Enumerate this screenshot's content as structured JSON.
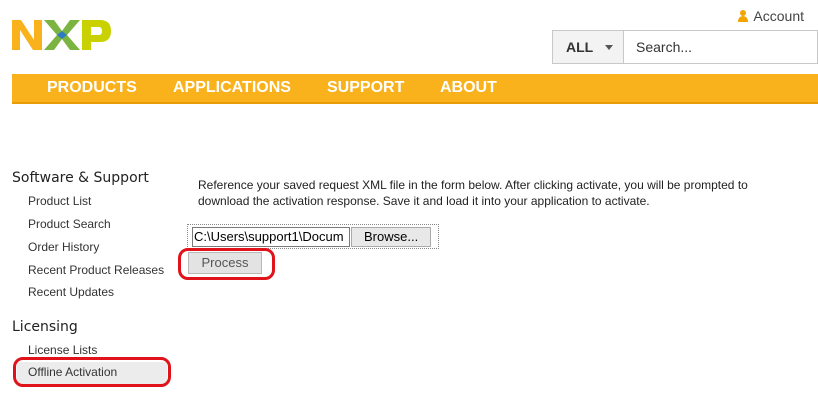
{
  "header": {
    "logo_alt": "NXP",
    "account_label": "Account",
    "search": {
      "scope": "ALL",
      "placeholder": "Search..."
    }
  },
  "nav": {
    "items": [
      "PRODUCTS",
      "APPLICATIONS",
      "SUPPORT",
      "ABOUT"
    ],
    "bar_color": "#f9b21b"
  },
  "sidebar": {
    "sections": [
      {
        "heading": "Software & Support",
        "links": [
          "Product List",
          "Product Search",
          "Order History",
          "Recent Product Releases",
          "Recent Updates"
        ]
      },
      {
        "heading": "Licensing",
        "links": [
          "License Lists",
          "Offline Activation"
        ]
      }
    ],
    "selected": "Offline Activation"
  },
  "main": {
    "description_line1": "Reference your saved request XML file in the form below. After clicking activate, you will be prompted to",
    "description_line2": "download the activation response. Save it and load it into your application to activate.",
    "file_path_value": "C:\\Users\\support1\\Docum",
    "browse_label": "Browse...",
    "process_label": "Process"
  },
  "annotation_color": "#e0131b"
}
